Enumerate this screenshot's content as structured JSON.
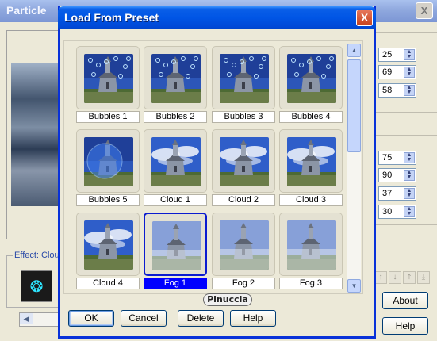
{
  "background_window": {
    "title": "Particle",
    "close_glyph": "X",
    "effect_label": "Effect: Cloud",
    "spinners_top": [
      "25",
      "69",
      "58"
    ],
    "spinners_bottom": [
      "75",
      "90",
      "37",
      "30"
    ],
    "about_label": "About",
    "help_label": "Help"
  },
  "dialog": {
    "title": "Load From Preset",
    "close_glyph": "X",
    "presets": [
      {
        "label": "Bubbles 1",
        "kind": "bubbles",
        "selected": false
      },
      {
        "label": "Bubbles 2",
        "kind": "bubbles",
        "selected": false
      },
      {
        "label": "Bubbles 3",
        "kind": "bubbles",
        "selected": false
      },
      {
        "label": "Bubbles 4",
        "kind": "bubbles",
        "selected": false
      },
      {
        "label": "Bubbles 5",
        "kind": "bigbubble",
        "selected": false
      },
      {
        "label": "Cloud 1",
        "kind": "cloud",
        "selected": false
      },
      {
        "label": "Cloud 2",
        "kind": "cloud",
        "selected": false
      },
      {
        "label": "Cloud 3",
        "kind": "cloud",
        "selected": false
      },
      {
        "label": "Cloud 4",
        "kind": "cloud",
        "selected": false
      },
      {
        "label": "Fog 1",
        "kind": "fog",
        "selected": true
      },
      {
        "label": "Fog 2",
        "kind": "fog",
        "selected": false
      },
      {
        "label": "Fog 3",
        "kind": "fog",
        "selected": false
      }
    ],
    "watermark": "Pinuccia",
    "buttons": {
      "ok": "OK",
      "cancel": "Cancel",
      "delete": "Delete",
      "help": "Help"
    }
  }
}
